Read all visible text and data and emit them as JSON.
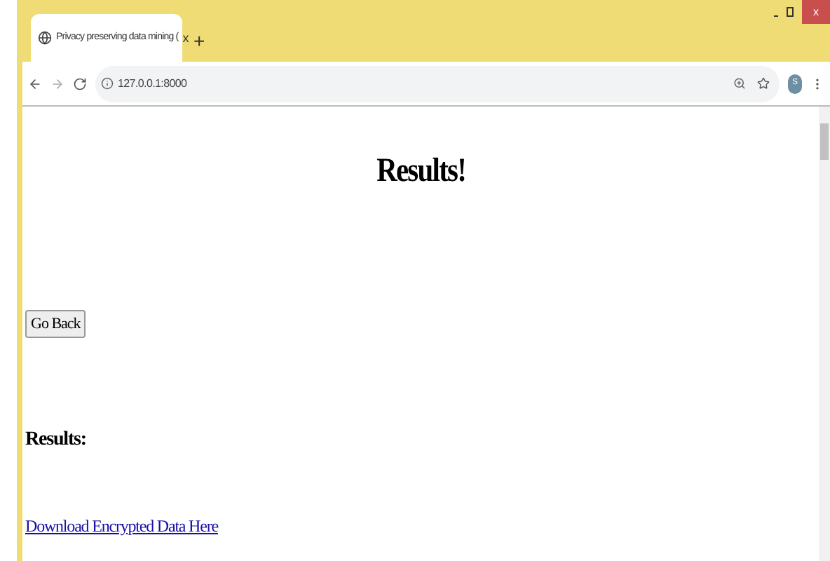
{
  "tab": {
    "title": "Privacy preserving data mining (",
    "close": "x",
    "new_tab": "+"
  },
  "window_controls": {
    "close": "x"
  },
  "address_bar": {
    "url": "127.0.0.1:8000"
  },
  "profile": {
    "initial": "S"
  },
  "page": {
    "heading": "Results!",
    "button": "Go Back",
    "subheading": "Results:",
    "link": "Download Encrypted Data Here"
  }
}
